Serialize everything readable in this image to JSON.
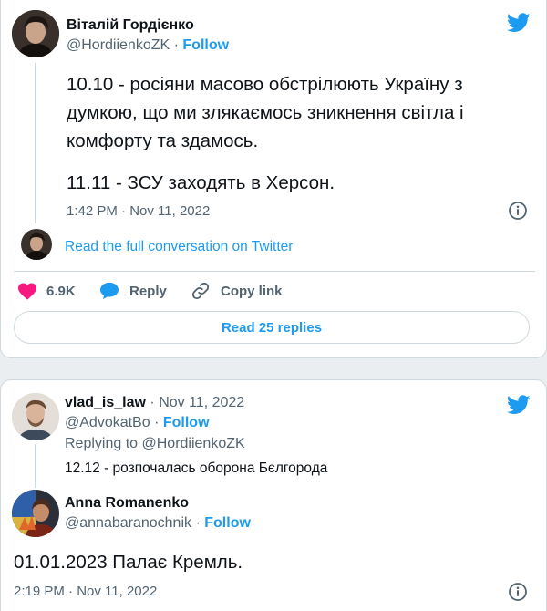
{
  "tweet1": {
    "author_name": "Віталій Гордієнко",
    "author_handle": "@HordiienkoZK",
    "separator": "·",
    "follow_label": "Follow",
    "text_lines": [
      "10.10 - росіяни масово обстрілюють Україну з",
      "думкою, що ми злякаємось зникнення світла і",
      "комфорту та здамось."
    ],
    "text_line_2": "11.11 - ЗСУ заходять в Херсон.",
    "timestamp": "1:42 PM · Nov 11, 2022",
    "read_full_label": "Read the full conversation on Twitter",
    "likes_count": "6.9K",
    "reply_label": "Reply",
    "copy_link_label": "Copy link",
    "read_replies_label": "Read 25 replies"
  },
  "tweet2": {
    "reply1": {
      "author_name": "vlad_is_law",
      "date": "Nov 11, 2022",
      "author_handle": "@AdvokatBo",
      "follow_label": "Follow",
      "replying_to": "Replying to @HordiienkoZK",
      "text": "12.12 - розпочалась оборона Бєлгорода"
    },
    "reply2": {
      "author_name": "Anna Romanenko",
      "author_handle": "@annabaranochnik",
      "follow_label": "Follow",
      "text": "01.01.2023 Палає Кремль.",
      "timestamp": "2:19 PM · Nov 11, 2022"
    }
  },
  "colors": {
    "accent": "#1d9bf0",
    "heart": "#f91880",
    "muted": "#536471"
  },
  "icons": {
    "brand": "twitter-bird-icon",
    "like": "heart-icon",
    "reply": "speech-bubble-icon",
    "copy": "link-icon",
    "info": "info-icon"
  }
}
